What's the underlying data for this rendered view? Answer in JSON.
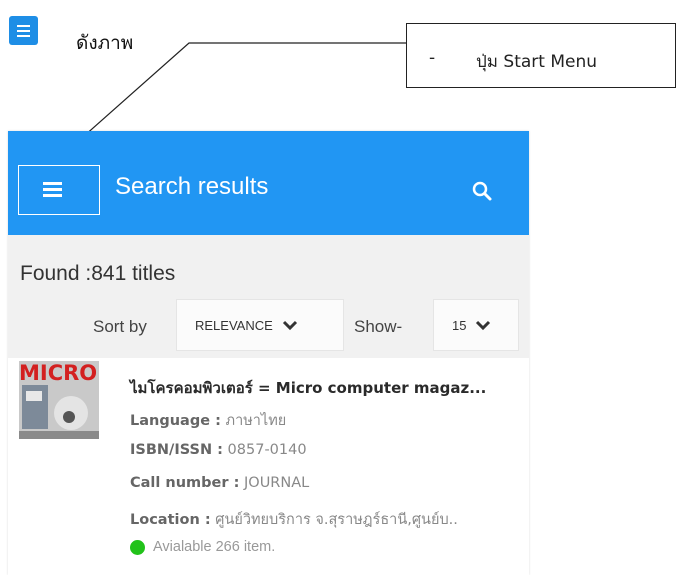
{
  "doc": {
    "caption": "ดังภาพ",
    "label_dash": "-",
    "label_text": "ปุ่ม Start Menu"
  },
  "app": {
    "title": "Search results",
    "accent_color": "#2196f3",
    "icons": {
      "menu": "hamburger-menu-icon",
      "search": "search-icon"
    }
  },
  "results_summary": {
    "found_text": "Found :841 titles",
    "sort_label": "Sort by",
    "sort_value": "RELEVANCE",
    "show_label": "Show-",
    "show_value": "15"
  },
  "result_item": {
    "thumbnail_text": "MICRO",
    "title": "ไมโครคอมพิวเตอร์ = Micro computer magaz...",
    "language_label": "Language :",
    "language_value": "ภาษาไทย",
    "isbn_label": "ISBN/ISSN :",
    "isbn_value": "0857-0140",
    "call_label": "Call number :",
    "call_value": "JOURNAL",
    "location_label": "Location :",
    "location_value": "ศูนย์วิทยบริการ จ.สุราษฎร์ธานี,ศูนย์บ..",
    "availability": "Avialable 266 item."
  }
}
